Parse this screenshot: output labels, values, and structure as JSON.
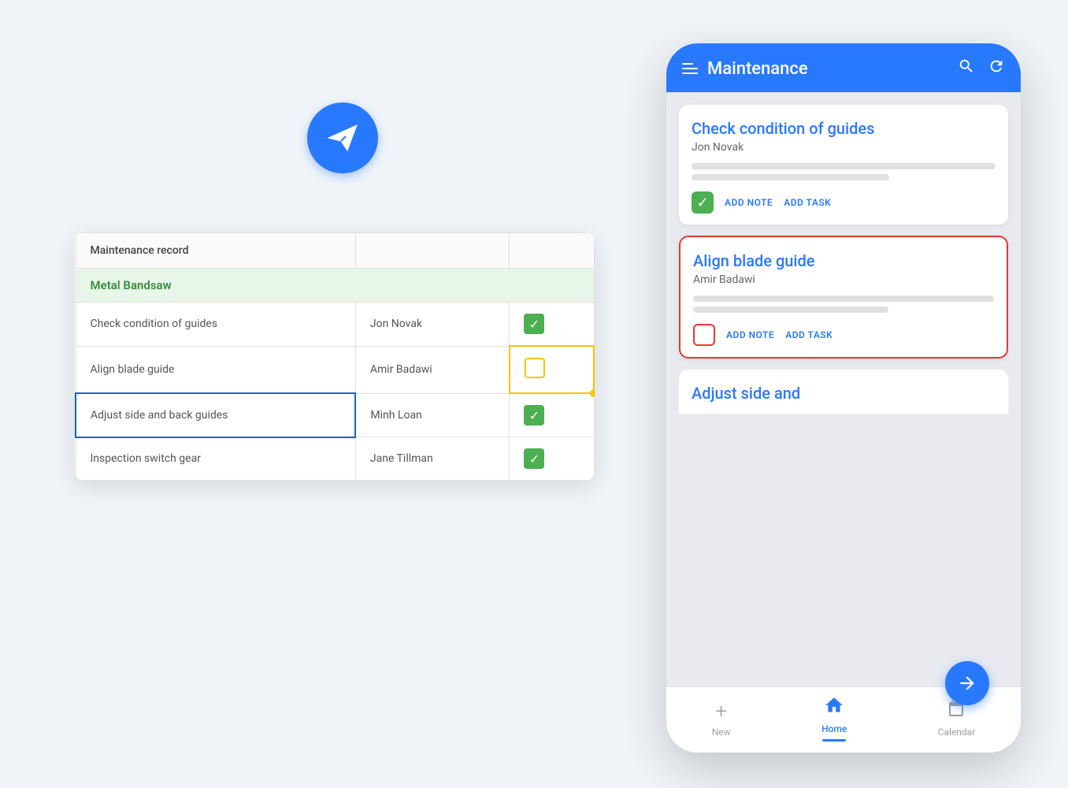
{
  "plane_icon": "✈",
  "spreadsheet": {
    "header_row": {
      "col1": "Maintenance record",
      "col2": "",
      "col3": ""
    },
    "section": "Metal Bandsaw",
    "rows": [
      {
        "task": "Check condition of guides",
        "person": "Jon Novak",
        "status": "checked"
      },
      {
        "task": "Align blade guide",
        "person": "Amir Badawi",
        "status": "empty_yellow"
      },
      {
        "task": "Adjust side and back guides",
        "person": "Minh Loan",
        "status": "checked",
        "selected": true
      },
      {
        "task": "Inspection switch gear",
        "person": "Jane Tillman",
        "status": "checked"
      }
    ]
  },
  "phone": {
    "header": {
      "title": "Maintenance",
      "search_icon": "search",
      "refresh_icon": "refresh"
    },
    "cards": [
      {
        "title": "Check condition of guides",
        "person": "Jon Novak",
        "checkbox": "green",
        "action1": "ADD NOTE",
        "action2": "ADD TASK",
        "selected": false
      },
      {
        "title": "Align blade guide",
        "person": "Amir Badawi",
        "checkbox": "red",
        "action1": "ADD NOTE",
        "action2": "ADD TASK",
        "selected": true
      },
      {
        "title": "Adjust side and",
        "person": "",
        "partial": true
      }
    ],
    "fab_icon": "➡",
    "nav": [
      {
        "label": "New",
        "icon": "+",
        "active": false
      },
      {
        "label": "Home",
        "icon": "⌂",
        "active": true
      },
      {
        "label": "Calendar",
        "icon": "▦",
        "active": false
      }
    ]
  }
}
